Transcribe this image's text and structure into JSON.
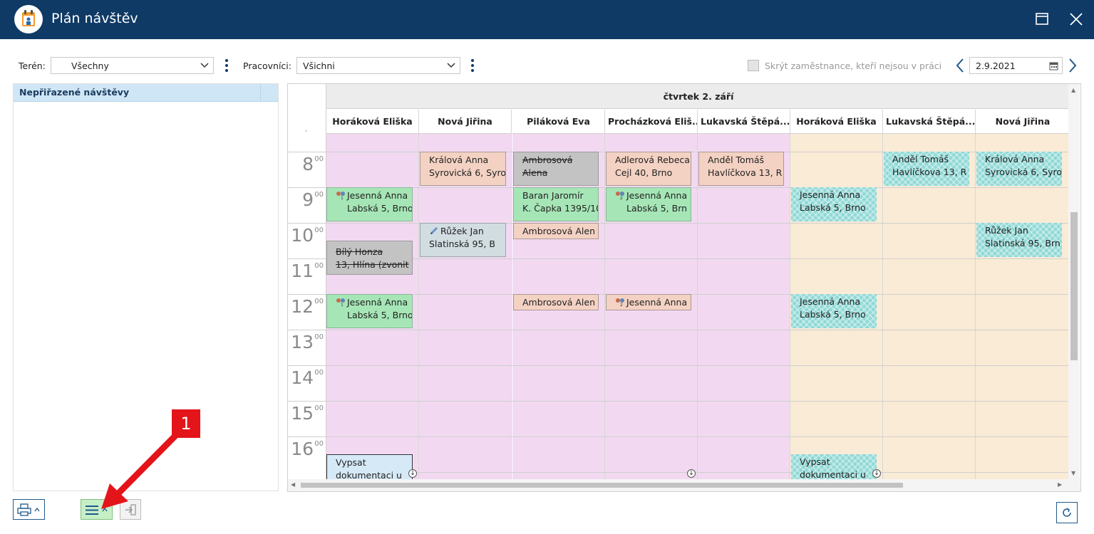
{
  "window": {
    "title": "Plán návštěv"
  },
  "toolbar": {
    "teren_label": "Terén:",
    "teren_value": "Všechny",
    "pracovnici_label": "Pracovníci:",
    "pracovnici_value": "Všichni",
    "hide_checkbox_label": "Skrýt zaměstnance, kteří nejsou v práci",
    "date_value": "2.9.2021"
  },
  "left_panel": {
    "header": "Nepřiřazené návštěvy"
  },
  "calendar": {
    "day_header": "čtvrtek 2. září",
    "columns": [
      "Horáková Eliška",
      "Nová Jiřina",
      "Piláková Eva",
      "Procházková Eliš...",
      "Lukavská Štěpá...",
      "Horáková Eliška",
      "Lukavská Štěpá...",
      "Nová Jiřina"
    ],
    "hours": [
      {
        "h": "8",
        "m": "00"
      },
      {
        "h": "9",
        "m": "00"
      },
      {
        "h": "10",
        "m": "00"
      },
      {
        "h": "11",
        "m": "00"
      },
      {
        "h": "12",
        "m": "00"
      },
      {
        "h": "13",
        "m": "00"
      },
      {
        "h": "14",
        "m": "00"
      },
      {
        "h": "15",
        "m": "00"
      },
      {
        "h": "16",
        "m": "00"
      }
    ],
    "events": {
      "e1": {
        "l1": "Králová Anna",
        "l2": "Syrovická 6, Syro"
      },
      "e2": {
        "l1": "Ambrosová",
        "l2": "Alena"
      },
      "e3": {
        "l1": "Adlerová Rebeca",
        "l2": "Cejl 40, Brno"
      },
      "e4": {
        "l1": "Anděl Tomáš",
        "l2": "Havlíčkova 13, R"
      },
      "e5": {
        "l1": "Anděl Tomáš",
        "l2": "Havlíčkova 13, R"
      },
      "e6": {
        "l1": "Králová Anna",
        "l2": "Syrovická 6, Syro"
      },
      "e7": {
        "l1": "Jesenná Anna",
        "l2": "Labská 5, Brno"
      },
      "e8": {
        "l1": "Baran Jaromír",
        "l2": "K. Čapka 1395/10"
      },
      "e9": {
        "l1": "Jesenná Anna",
        "l2": "Labská 5, Brn"
      },
      "e10": {
        "l1": "Jesenná Anna",
        "l2": "Labská 5, Brno"
      },
      "e11": {
        "l1": "Růžek Jan",
        "l2": "Slatinská 95, B"
      },
      "e12": {
        "l1": "Ambrosová Alen"
      },
      "e13": {
        "l1": "Růžek Jan",
        "l2": "Slatinská 95, Brn"
      },
      "e14": {
        "l1": "Bílý Honza",
        "l2": "13, Hlína (zvonit"
      },
      "e15": {
        "l1": "Jesenná Anna",
        "l2": "Labská 5, Brno"
      },
      "e16": {
        "l1": "Ambrosová Alen"
      },
      "e17": {
        "l1": "Jesenná Anna"
      },
      "e18": {
        "l1": "Jesenná Anna",
        "l2": "Labská 5, Brno"
      },
      "e19": {
        "l1": "Vypsat",
        "l2": "dokumentaci u"
      },
      "e20": {
        "l1": "Vypsat",
        "l2": "dokumentaci u"
      }
    }
  },
  "annotation": {
    "badge": "1"
  },
  "colors": {
    "titlebar": "#0f3a66",
    "pink_column": "#f2d9f1",
    "tan_column": "#faebd6",
    "green_button": "#c6efc6",
    "annotation_red": "#e3151a"
  }
}
